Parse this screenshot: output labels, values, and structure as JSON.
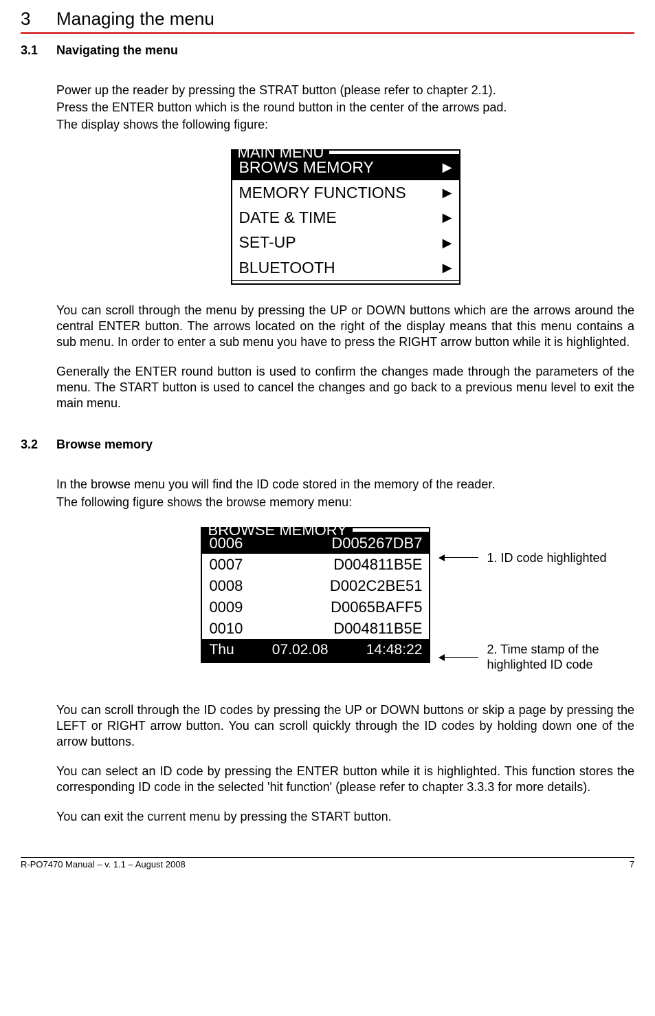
{
  "chapter": {
    "num": "3",
    "title": "Managing the menu"
  },
  "s31": {
    "num": "3.1",
    "title": "Navigating the menu",
    "p1": "Power up the reader by pressing the STRAT button (please refer to chapter 2.1).",
    "p2": "Press the ENTER button which is the round button in the center of the arrows pad.",
    "p3": "The display shows the following figure:",
    "p4": "You can scroll through the menu by pressing the UP or DOWN buttons which are the arrows around the central ENTER button. The arrows located on the right of the display means that this menu contains a sub menu. In order to enter a sub menu you have to press the RIGHT arrow button while it is highlighted.",
    "p5": "Generally the ENTER round button is used to confirm the changes made through the parameters of the menu. The START button is used to cancel the changes and go back to a previous menu level to exit the main menu."
  },
  "screen1": {
    "title": "MAIN MENU",
    "items": [
      {
        "label": "BROWS MEMORY",
        "selected": true
      },
      {
        "label": "MEMORY FUNCTIONS",
        "selected": false
      },
      {
        "label": "DATE & TIME",
        "selected": false
      },
      {
        "label": "SET-UP",
        "selected": false
      },
      {
        "label": "BLUETOOTH",
        "selected": false
      }
    ]
  },
  "s32": {
    "num": "3.2",
    "title": "Browse memory",
    "p1": "In the browse menu you will find the ID code stored in the memory of the reader.",
    "p2": "The following figure shows the browse memory menu:",
    "p3": "You can scroll through the ID codes by pressing the UP or DOWN buttons or skip a page by pressing the LEFT or RIGHT arrow button. You can scroll quickly through the ID codes by holding down one of the arrow buttons.",
    "p4": "You can select an ID code by pressing the ENTER button while it is highlighted. This function stores the corresponding ID code in the selected 'hit function' (please refer to chapter 3.3.3 for more details).",
    "p5": "You can exit the current menu by pressing the START button."
  },
  "screen2": {
    "title": "BROWSE MEMORY",
    "rows": [
      {
        "idx": "0006",
        "code": "D005267DB7",
        "selected": true
      },
      {
        "idx": "0007",
        "code": "D004811B5E",
        "selected": false
      },
      {
        "idx": "0008",
        "code": "D002C2BE51",
        "selected": false
      },
      {
        "idx": "0009",
        "code": "D0065BAFF5",
        "selected": false
      },
      {
        "idx": "0010",
        "code": "D004811B5E",
        "selected": false
      }
    ],
    "footer": {
      "day": "Thu",
      "date": "07.02.08",
      "time": "14:48:22"
    }
  },
  "annot": {
    "a1": "1. ID code highlighted",
    "a2a": "2. Time stamp of the",
    "a2b": "highlighted ID code"
  },
  "footer": {
    "left": "R-PO7470 Manual – v. 1.1 – August 2008",
    "right": "7"
  }
}
